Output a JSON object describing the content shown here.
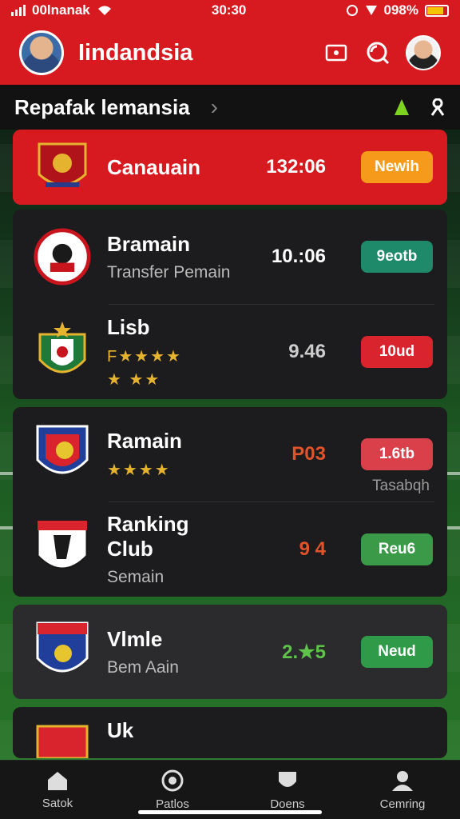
{
  "status": {
    "carrier": "00lnanak",
    "time": "30:30",
    "battery": "098%"
  },
  "header": {
    "title": "Iindandsia"
  },
  "subheader": {
    "title": "Repafak lemansia"
  },
  "list": [
    {
      "name": "Canauain",
      "sub": "",
      "stars": "",
      "stars2": "",
      "score": "132:06",
      "score_color": "#ffffff",
      "pill": "Newih",
      "pill_color": "#f59a1a",
      "note": ""
    },
    {
      "name": "Bramain",
      "sub": "Transfer Pemain",
      "stars": "",
      "stars2": "",
      "score": "10.:06",
      "score_color": "#ffffff",
      "pill": "9eotb",
      "pill_color": "#1f8a6a",
      "note": ""
    },
    {
      "name": "Lisb",
      "sub": "",
      "stars": "F★★★★",
      "stars2": "★  ★★",
      "score": "9.46",
      "score_color": "#cccccc",
      "pill": "10ud",
      "pill_color": "#d9232d",
      "note": ""
    },
    {
      "name": "Ramain",
      "sub": "",
      "stars": "★★★★",
      "stars2": "",
      "score": "P03",
      "score_color": "#e0532b",
      "pill": "1.6tb",
      "pill_color": "#d9404a",
      "note": "Tasabqh"
    },
    {
      "name": "Ranking Club",
      "sub": "Semain",
      "stars": "",
      "stars2": "",
      "score": "9 4",
      "score_color": "#e0532b",
      "pill": "Reu6",
      "pill_color": "#3a9a48",
      "note": ""
    },
    {
      "name": "Vlmle",
      "sub": "Bem Aain",
      "stars": "",
      "stars2": "",
      "score": "2.★5",
      "score_color": "#5fc24a",
      "pill": "Neud",
      "pill_color": "#2f9a48",
      "note": ""
    },
    {
      "name": "Uk",
      "sub": "",
      "stars": "",
      "stars2": "",
      "score": "",
      "score_color": "#ffffff",
      "pill": "",
      "pill_color": "#1f8a4a",
      "note": ""
    }
  ],
  "nav": [
    {
      "label": "Satok",
      "icon": "home-icon"
    },
    {
      "label": "Patlos",
      "icon": "ball-icon"
    },
    {
      "label": "Doens",
      "icon": "shield-icon"
    },
    {
      "label": "Cemring",
      "icon": "user-icon"
    }
  ]
}
